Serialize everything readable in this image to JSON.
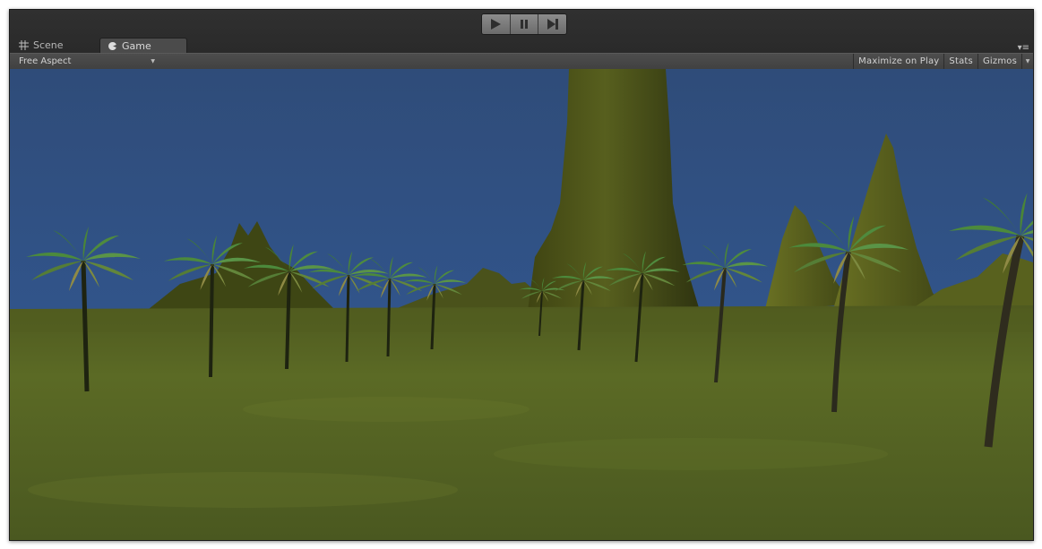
{
  "play_controls": {
    "play": "play-icon",
    "pause": "pause-icon",
    "step": "step-icon"
  },
  "tabs": [
    {
      "label": "Scene",
      "icon": "scene-grid-icon",
      "active": false
    },
    {
      "label": "Game",
      "icon": "game-controller-icon",
      "active": true
    }
  ],
  "toolbar": {
    "aspect": "Free Aspect",
    "maximize": "Maximize on Play",
    "stats": "Stats",
    "gizmos": "Gizmos"
  },
  "colors": {
    "sky": "#2f4e7c",
    "ground": "#5c6a26",
    "window_bg": "#383838"
  }
}
